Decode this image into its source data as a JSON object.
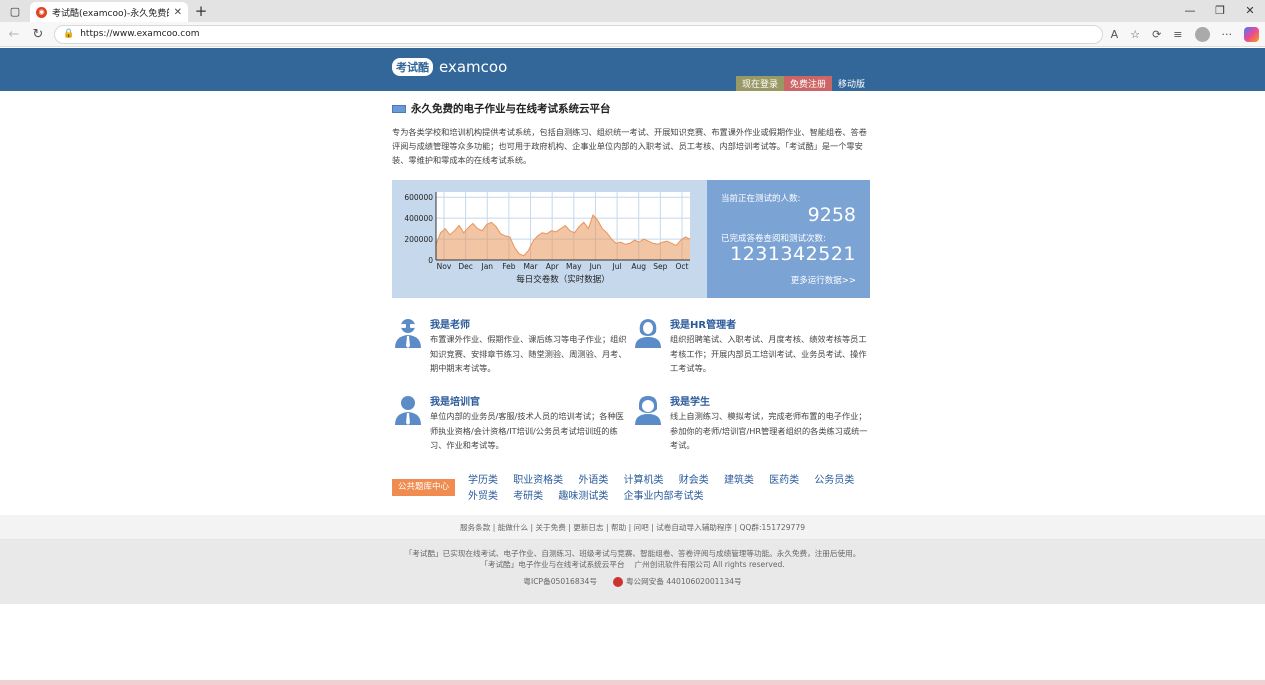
{
  "browser": {
    "tab_title": "考试酷(examcoo)-永久免费的电子",
    "url": "https://www.examcoo.com"
  },
  "header": {
    "logo_badge": "考试酷",
    "logo_name": "examcoo",
    "nav": [
      "现在登录",
      "免费注册",
      "移动版"
    ]
  },
  "intro": {
    "title": "永久免费的电子作业与在线考试系统云平台",
    "text": "专为各类学校和培训机构提供考试系统，包括自测练习、组织统一考试、开展知识竞赛、布置课外作业或假期作业、智能组卷、答卷评阅与成绩管理等众多功能；也可用于政府机构、企事业单位内部的入职考试、员工考核、内部培训考试等。「考试酷」是一个零安装、零维护和零成本的在线考试系统。"
  },
  "stats": {
    "label_testing": "当前正在测试的人数:",
    "value_testing": "9258",
    "label_completed": "已完成答卷查阅和测试次数:",
    "value_completed": "1231342521",
    "more": "更多运行数据>>"
  },
  "chart_data": {
    "type": "area",
    "title": "",
    "xlabel": "每日交卷数（实时数据）",
    "ylabel": "",
    "x_ticks": [
      "Nov",
      "Dec",
      "Jan",
      "Feb",
      "Mar",
      "Apr",
      "May",
      "Jun",
      "Jul",
      "Aug",
      "Sep",
      "Oct"
    ],
    "y_ticks": [
      0,
      200000,
      400000,
      600000
    ],
    "ylim": [
      0,
      650000
    ],
    "grid": true,
    "series": [
      {
        "values": [
          150000,
          260000,
          300000,
          240000,
          280000,
          330000,
          260000,
          310000,
          350000,
          300000,
          280000,
          340000,
          360000,
          320000,
          250000,
          230000,
          220000,
          120000,
          60000,
          40000,
          90000,
          180000,
          230000,
          260000,
          250000,
          280000,
          270000,
          300000,
          330000,
          280000,
          260000,
          320000,
          360000,
          300000,
          430000,
          380000,
          300000,
          260000,
          200000,
          160000,
          170000,
          150000,
          160000,
          190000,
          170000,
          200000,
          180000,
          160000,
          150000,
          170000,
          180000,
          160000,
          140000,
          190000,
          220000,
          200000
        ]
      }
    ]
  },
  "roles": [
    {
      "title": "我是老师",
      "desc": "布置课外作业、假期作业、课后练习等电子作业；组织知识竞赛、安排章节练习、随堂测验、周测验、月考、期中期末考试等。"
    },
    {
      "title": "我是HR管理者",
      "desc": "组织招聘笔试、入职考试、月度考核、绩效考核等员工考核工作；开展内部员工培训考试、业务员考试、操作工考试等。"
    },
    {
      "title": "我是培训官",
      "desc": "单位内部的业务员/客服/技术人员的培训考试；各种医师执业资格/会计资格/IT培训/公务员考试培训班的练习、作业和考试等。"
    },
    {
      "title": "我是学生",
      "desc": "线上自测练习、模拟考试，完成老师布置的电子作业；参加你的老师/培训官/HR管理者组织的各类练习或统一考试。"
    }
  ],
  "bank": {
    "tag": "公共题库中心",
    "links": [
      "学历类",
      "职业资格类",
      "外语类",
      "计算机类",
      "财会类",
      "建筑类",
      "医药类",
      "公务员类",
      "外贸类",
      "考研类",
      "趣味测试类",
      "企事业内部考试类"
    ]
  },
  "footer": {
    "links": "服务条款 | 能做什么 | 关于免费 | 更新日志 | 帮助 | 问吧 | 试卷自动导入辅助程序 | QQ群:151729779",
    "line1": "「考试酷」已实现在线考试、电子作业、自测练习、班级考试与竞赛、智能组卷、答卷评阅与成绩管理等功能。永久免费，注册后使用。",
    "line2": "「考试酷」电子作业与在线考试系统云平台　 广州创讯软件有限公司  All rights reserved.",
    "icp": "粤ICP备05016834号",
    "police": "粤公网安备 44010602001134号"
  },
  "colors": {
    "header_bg": "#336699",
    "login_btn": "#999966",
    "register_btn": "#cc6666",
    "chart_bg": "#c5d8ec",
    "stat_bg": "#7ba3d4",
    "bank_tag": "#f08c50",
    "series": "#e8955a"
  }
}
